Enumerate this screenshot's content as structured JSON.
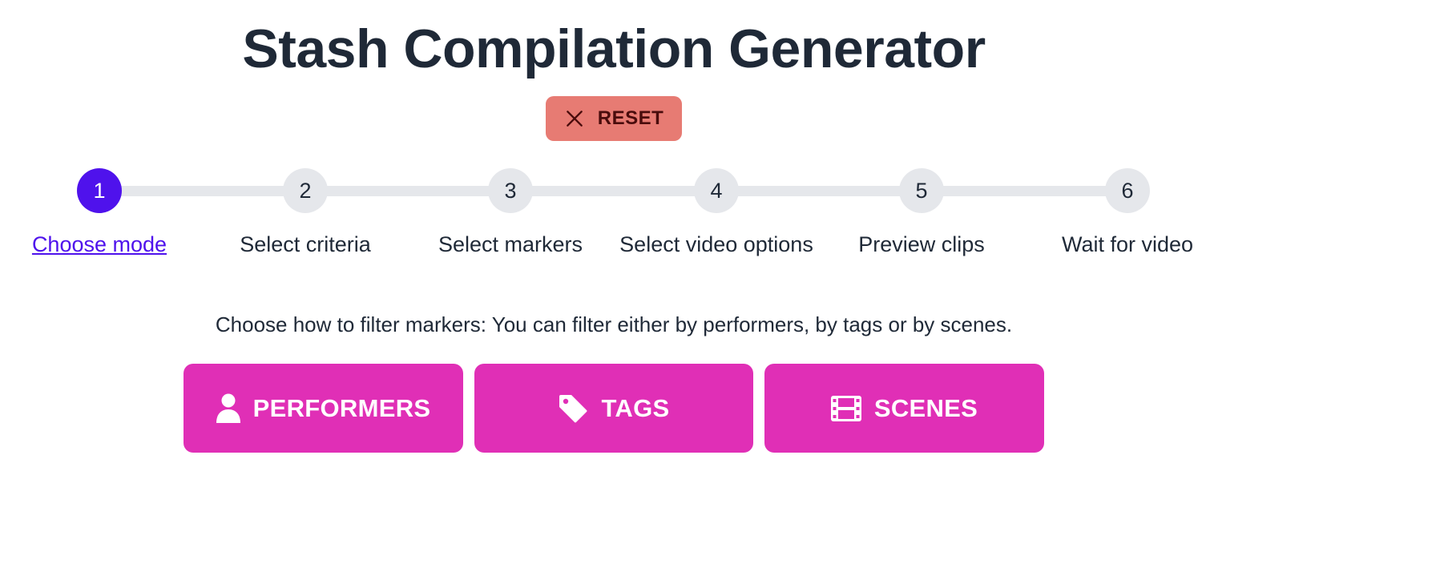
{
  "app": {
    "title": "Stash Compilation Generator"
  },
  "reset": {
    "label": "RESET",
    "icon": "close-icon",
    "color": "#e77b73"
  },
  "stepper": {
    "active_step": 1,
    "active_color": "#4f12ec",
    "steps": [
      {
        "number": "1",
        "label": "Choose mode"
      },
      {
        "number": "2",
        "label": "Select criteria"
      },
      {
        "number": "3",
        "label": "Select markers"
      },
      {
        "number": "4",
        "label": "Select video options"
      },
      {
        "number": "5",
        "label": "Preview clips"
      },
      {
        "number": "6",
        "label": "Wait for video"
      }
    ]
  },
  "mode": {
    "instructions": "Choose how to filter markers: You can filter either by performers, by tags or by scenes.",
    "button_color": "#e02fb6",
    "buttons": [
      {
        "label": "PERFORMERS",
        "icon": "user-icon"
      },
      {
        "label": "TAGS",
        "icon": "tag-icon"
      },
      {
        "label": "SCENES",
        "icon": "film-icon"
      }
    ]
  }
}
